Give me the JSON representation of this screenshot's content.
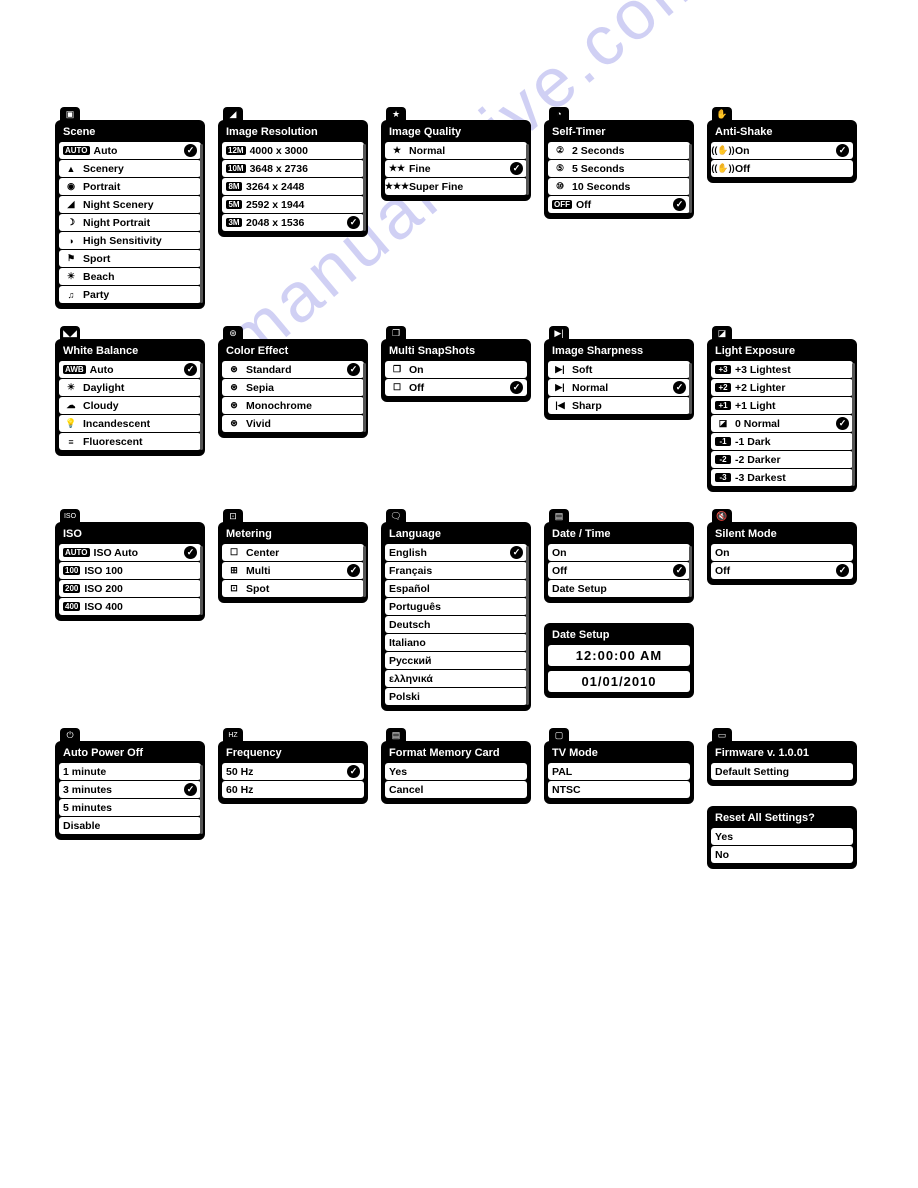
{
  "watermark": "manualshive.com",
  "panels": {
    "scene": {
      "title": "Scene",
      "items": [
        {
          "icon": "AUTO",
          "iconType": "badge",
          "label": "Auto",
          "selected": true
        },
        {
          "icon": "▲",
          "iconType": "pic",
          "label": "Scenery"
        },
        {
          "icon": "◉",
          "iconType": "pic",
          "label": "Portrait"
        },
        {
          "icon": "◢",
          "iconType": "pic",
          "label": "Night Scenery"
        },
        {
          "icon": "☽",
          "iconType": "pic",
          "label": "Night Portrait"
        },
        {
          "icon": "◑",
          "iconType": "pic",
          "label": "High Sensitivity"
        },
        {
          "icon": "⚑",
          "iconType": "pic",
          "label": "Sport"
        },
        {
          "icon": "☀",
          "iconType": "pic",
          "label": "Beach"
        },
        {
          "icon": "♫",
          "iconType": "pic",
          "label": "Party"
        }
      ]
    },
    "resolution": {
      "title": "Image Resolution",
      "items": [
        {
          "icon": "12M",
          "iconType": "badge",
          "label": "4000 x 3000"
        },
        {
          "icon": "10M",
          "iconType": "badge",
          "label": "3648 x 2736"
        },
        {
          "icon": "8M",
          "iconType": "badge",
          "label": "3264 x 2448"
        },
        {
          "icon": "5M",
          "iconType": "badge",
          "label": "2592 x 1944"
        },
        {
          "icon": "3M",
          "iconType": "badge",
          "label": "2048 x 1536",
          "selected": true
        }
      ]
    },
    "quality": {
      "title": "Image Quality",
      "items": [
        {
          "icon": "★",
          "label": "Normal"
        },
        {
          "icon": "★★",
          "label": "Fine",
          "selected": true
        },
        {
          "icon": "★★★",
          "label": "Super Fine"
        }
      ]
    },
    "selftimer": {
      "title": "Self-Timer",
      "items": [
        {
          "icon": "②",
          "label": "2 Seconds"
        },
        {
          "icon": "⑤",
          "label": "5 Seconds"
        },
        {
          "icon": "⑩",
          "label": "10 Seconds"
        },
        {
          "icon": "OFF",
          "iconType": "badge",
          "label": "Off",
          "selected": true
        }
      ]
    },
    "antishake": {
      "title": "Anti-Shake",
      "items": [
        {
          "icon": "((✋))",
          "label": "On",
          "selected": true
        },
        {
          "icon": "((✋))",
          "label": "Off"
        }
      ]
    },
    "wb": {
      "title": "White Balance",
      "items": [
        {
          "icon": "AWB",
          "iconType": "badge",
          "label": "Auto",
          "selected": true
        },
        {
          "icon": "☀",
          "label": "Daylight"
        },
        {
          "icon": "☁",
          "label": "Cloudy"
        },
        {
          "icon": "💡",
          "label": "Incandescent"
        },
        {
          "icon": "≡",
          "label": "Fluorescent"
        }
      ]
    },
    "color": {
      "title": "Color Effect",
      "items": [
        {
          "icon": "⊛",
          "label": "Standard",
          "selected": true
        },
        {
          "icon": "⊛",
          "label": "Sepia"
        },
        {
          "icon": "⊛",
          "label": "Monochrome"
        },
        {
          "icon": "⊛",
          "label": "Vivid"
        }
      ]
    },
    "multi": {
      "title": "Multi SnapShots",
      "items": [
        {
          "icon": "❐",
          "label": "On"
        },
        {
          "icon": "☐",
          "label": "Off",
          "selected": true
        }
      ]
    },
    "sharpness": {
      "title": "Image Sharpness",
      "items": [
        {
          "icon": "▶|",
          "label": "Soft"
        },
        {
          "icon": "▶|",
          "label": "Normal",
          "selected": true
        },
        {
          "icon": "|◀",
          "label": "Sharp"
        }
      ]
    },
    "exposure": {
      "title": "Light Exposure",
      "items": [
        {
          "icon": "+3",
          "iconType": "badge",
          "label": "+3 Lightest"
        },
        {
          "icon": "+2",
          "iconType": "badge",
          "label": "+2 Lighter"
        },
        {
          "icon": "+1",
          "iconType": "badge",
          "label": "+1 Light"
        },
        {
          "icon": "◪",
          "label": "0 Normal",
          "selected": true
        },
        {
          "icon": "-1",
          "iconType": "badge",
          "label": "-1 Dark"
        },
        {
          "icon": "-2",
          "iconType": "badge",
          "label": "-2 Darker"
        },
        {
          "icon": "-3",
          "iconType": "badge",
          "label": "-3 Darkest"
        }
      ]
    },
    "iso": {
      "title": "ISO",
      "tabLabel": "ISO",
      "items": [
        {
          "icon": "AUTO",
          "iconType": "badge",
          "label": "ISO Auto",
          "selected": true
        },
        {
          "icon": "100",
          "iconType": "badge",
          "label": "ISO 100"
        },
        {
          "icon": "200",
          "iconType": "badge",
          "label": "ISO 200"
        },
        {
          "icon": "400",
          "iconType": "badge",
          "label": "ISO 400"
        }
      ]
    },
    "metering": {
      "title": "Metering",
      "items": [
        {
          "icon": "☐",
          "label": "Center"
        },
        {
          "icon": "⊞",
          "label": "Multi",
          "selected": true
        },
        {
          "icon": "⊡",
          "label": "Spot"
        }
      ]
    },
    "language": {
      "title": "Language",
      "items": [
        {
          "label": "English",
          "selected": true
        },
        {
          "label": "Français"
        },
        {
          "label": "Español"
        },
        {
          "label": "Português"
        },
        {
          "label": "Deutsch"
        },
        {
          "label": "Italiano"
        },
        {
          "label": "Русский"
        },
        {
          "label": "ελληνικά"
        },
        {
          "label": "Polski"
        }
      ]
    },
    "datetime": {
      "title": "Date / Time",
      "items": [
        {
          "label": "On"
        },
        {
          "label": "Off",
          "selected": true
        },
        {
          "label": "Date Setup"
        }
      ]
    },
    "datesetup": {
      "title": "Date Setup",
      "time": "12:00:00 AM",
      "date": "01/01/2010"
    },
    "silent": {
      "title": "Silent Mode",
      "items": [
        {
          "label": "On"
        },
        {
          "label": "Off",
          "selected": true
        }
      ]
    },
    "poweroff": {
      "title": "Auto Power Off",
      "items": [
        {
          "label": "1 minute"
        },
        {
          "label": "3 minutes",
          "selected": true
        },
        {
          "label": "5 minutes"
        },
        {
          "label": "Disable"
        }
      ]
    },
    "frequency": {
      "title": "Frequency",
      "tabLabel": "HZ",
      "items": [
        {
          "label": "50 Hz",
          "selected": true
        },
        {
          "label": "60 Hz"
        }
      ]
    },
    "format": {
      "title": "Format Memory Card",
      "items": [
        {
          "label": "Yes"
        },
        {
          "label": "Cancel"
        }
      ]
    },
    "tvmode": {
      "title": "TV  Mode",
      "items": [
        {
          "label": "PAL"
        },
        {
          "label": "NTSC"
        }
      ]
    },
    "firmware": {
      "title": "Firmware v. 1.0.01",
      "items": [
        {
          "label": "Default Setting"
        }
      ]
    },
    "reset": {
      "title": "Reset All Settings?",
      "items": [
        {
          "label": "Yes"
        },
        {
          "label": "No"
        }
      ]
    }
  }
}
